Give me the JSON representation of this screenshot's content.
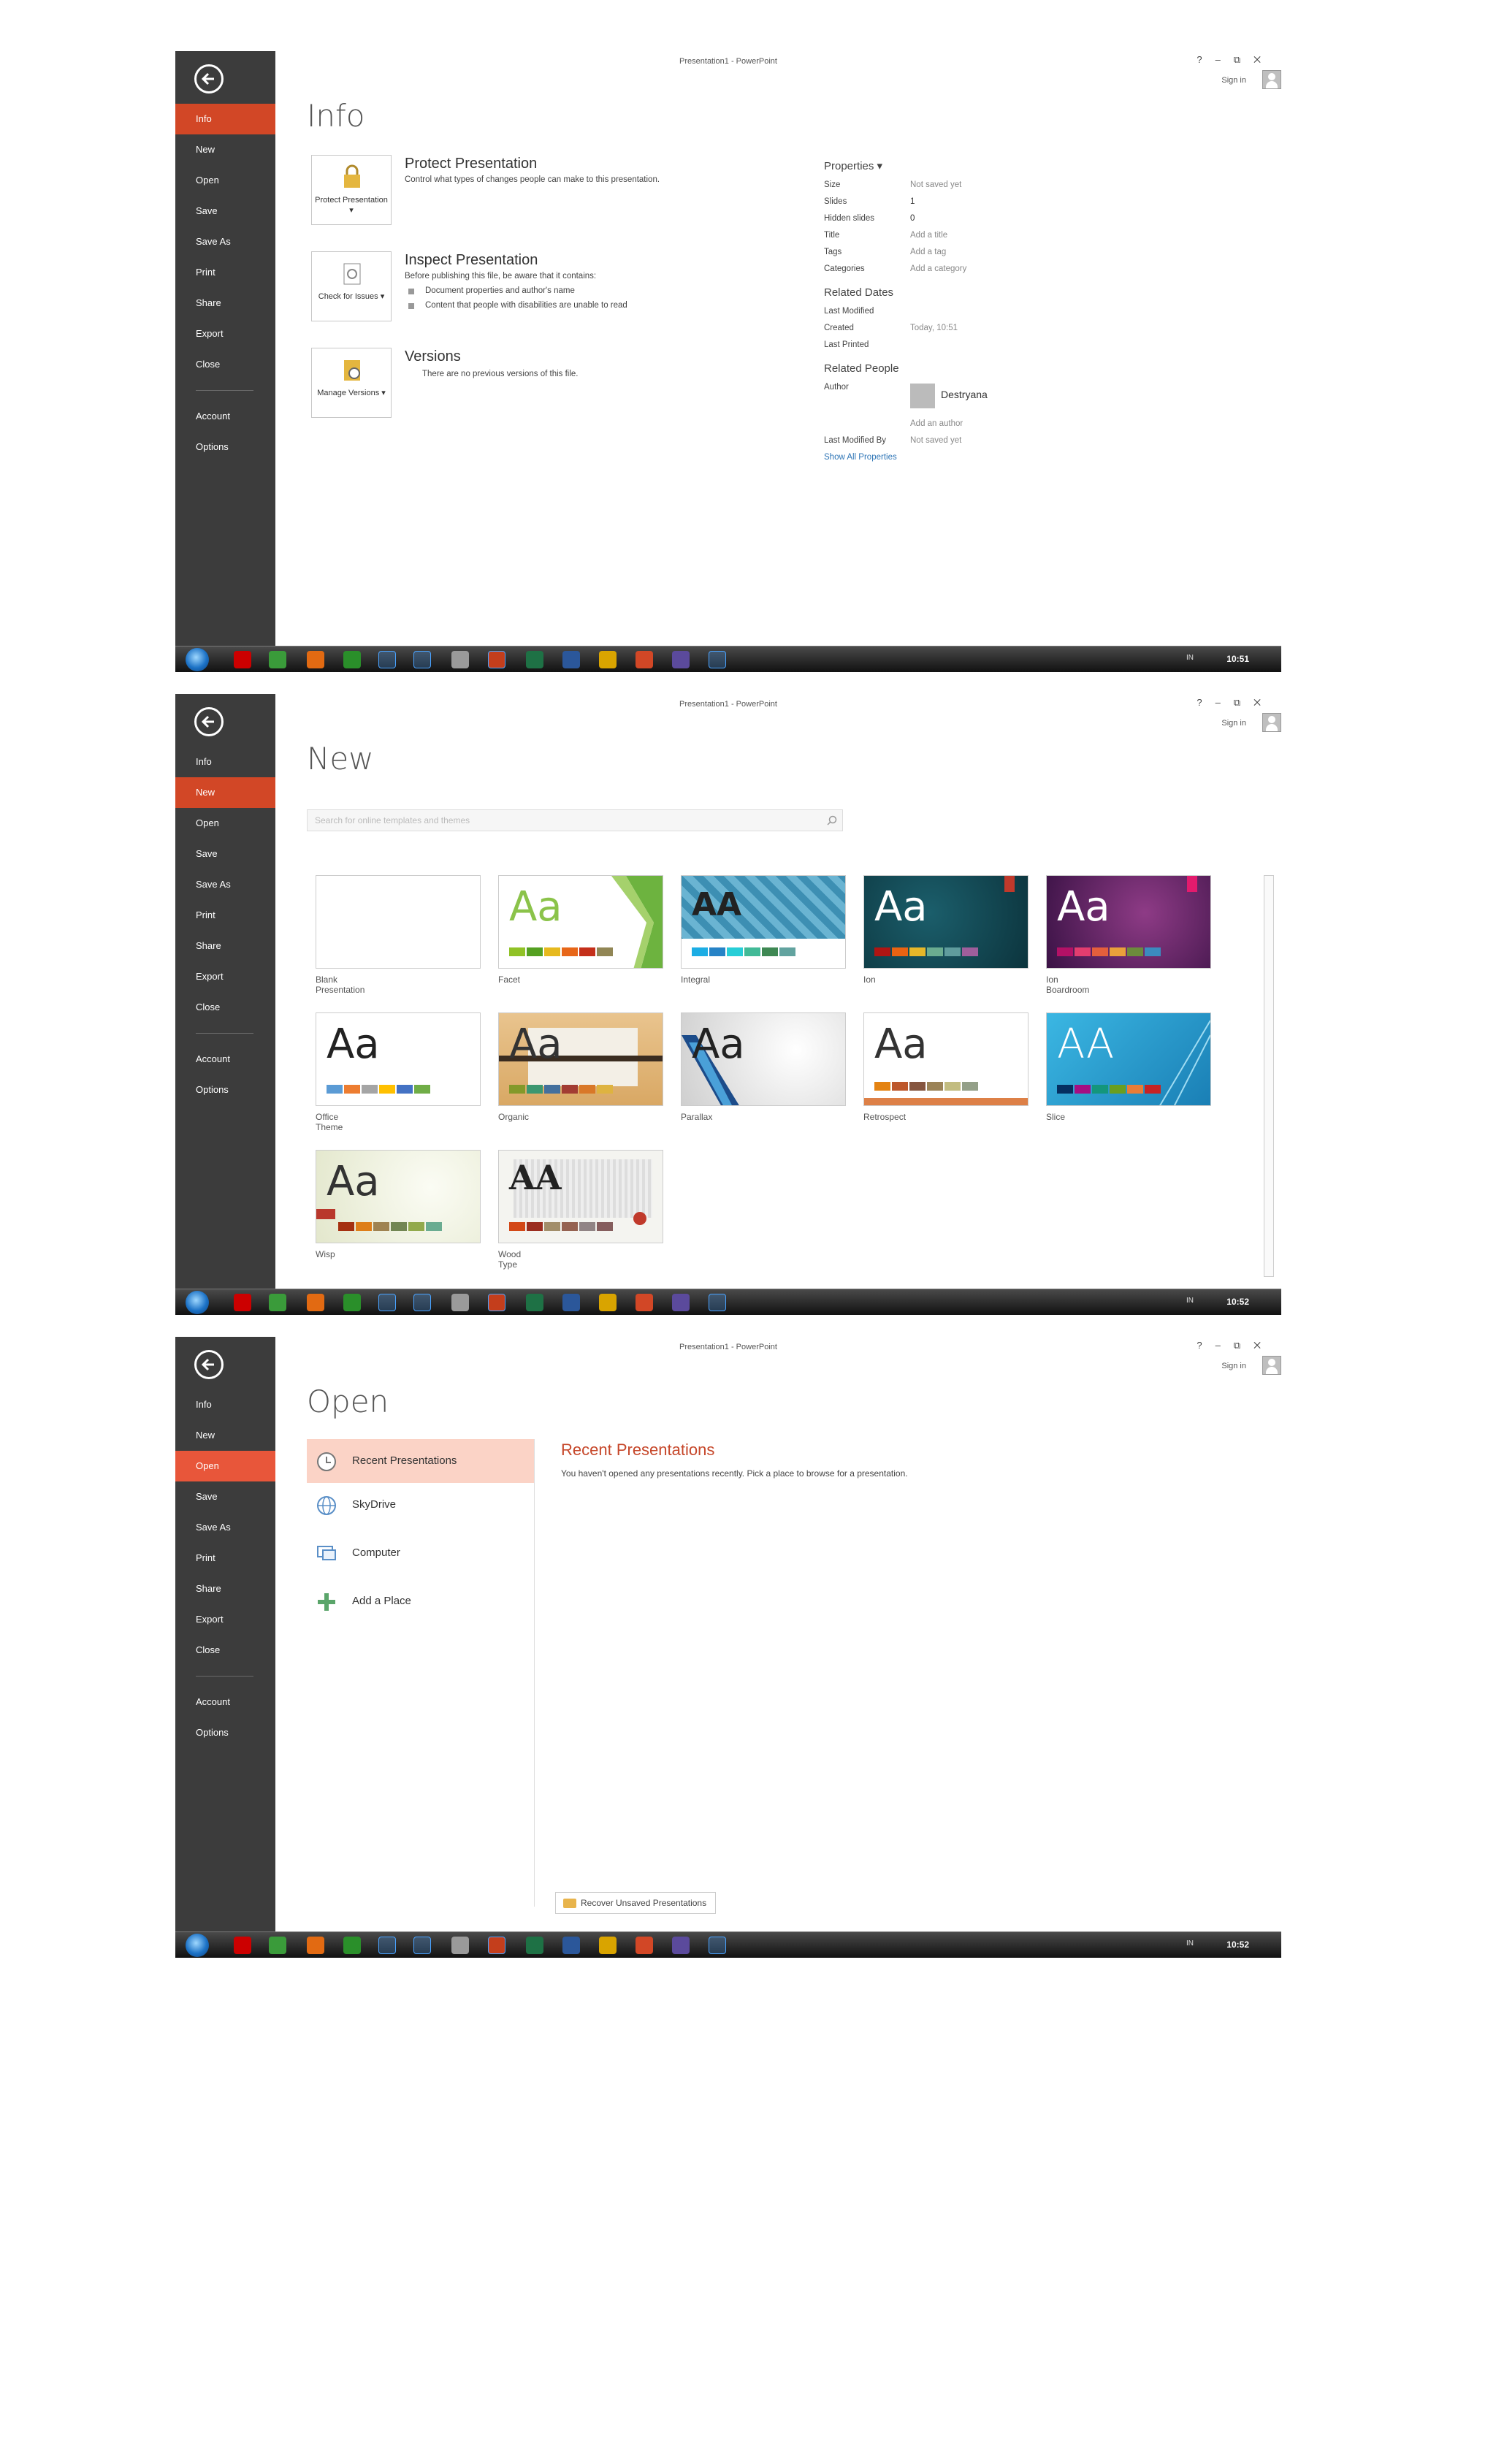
{
  "titlebar": {
    "title": "Presentation1 - PowerPoint",
    "help": "?",
    "minimize": "–",
    "restore": "⧉",
    "close": "✕",
    "sign_in": "Sign in"
  },
  "menu": {
    "info": "Info",
    "new": "New",
    "open": "Open",
    "save": "Save",
    "save_as": "Save As",
    "print": "Print",
    "share": "Share",
    "export": "Export",
    "close": "Close",
    "account": "Account",
    "options": "Options"
  },
  "taskbar": {
    "tray_lang": "IN",
    "clock_1": "10:51",
    "clock_2": "10:52",
    "clock_3": "10:52"
  },
  "info": {
    "title": "Info",
    "protect": {
      "button": "Protect Presentation ▾",
      "title": "Protect Presentation",
      "desc": "Control what types of changes people can make to this presentation."
    },
    "inspect": {
      "button": "Check for Issues ▾",
      "title": "Inspect Presentation",
      "desc": "Before publishing this file, be aware that it contains:",
      "bullet1": "Document properties and author's name",
      "bullet2": "Content that people with disabilities are unable to read"
    },
    "versions": {
      "button": "Manage Versions ▾",
      "title": "Versions",
      "desc": "There are no previous versions of this file."
    },
    "properties": {
      "heading": "Properties ▾",
      "size_k": "Size",
      "size_v": "Not saved yet",
      "slides_k": "Slides",
      "slides_v": "1",
      "hidden_k": "Hidden slides",
      "hidden_v": "0",
      "title_k": "Title",
      "title_v": "Add a title",
      "tags_k": "Tags",
      "tags_v": "Add a tag",
      "categories_k": "Categories",
      "categories_v": "Add a category",
      "dates_heading": "Related Dates",
      "last_modified_k": "Last Modified",
      "created_k": "Created",
      "created_v": "Today, 10:51",
      "last_printed_k": "Last Printed",
      "people_heading": "Related People",
      "author_k": "Author",
      "author_v": "Destryana",
      "add_author": "Add an author",
      "last_modified_by_k": "Last Modified By",
      "last_modified_by_v": "Not saved yet",
      "show_all": "Show All Properties"
    }
  },
  "new": {
    "title": "New",
    "search_placeholder": "Search for online templates and themes",
    "templates": [
      {
        "name": "Blank Presentation"
      },
      {
        "name": "Facet"
      },
      {
        "name": "Integral"
      },
      {
        "name": "Ion"
      },
      {
        "name": "Ion Boardroom"
      },
      {
        "name": "Office Theme"
      },
      {
        "name": "Organic"
      },
      {
        "name": "Parallax"
      },
      {
        "name": "Retrospect"
      },
      {
        "name": "Slice"
      },
      {
        "name": "Wisp"
      },
      {
        "name": "Wood Type"
      }
    ],
    "aa": "Aa",
    "aa_caps": "AA"
  },
  "open": {
    "title": "Open",
    "places": {
      "recent": "Recent Presentations",
      "skydrive": "SkyDrive",
      "computer": "Computer",
      "add_place": "Add a Place"
    },
    "recent_title": "Recent Presentations",
    "recent_desc": "You haven't opened any presentations recently. Pick a place to browse for a presentation.",
    "recover": "Recover Unsaved Presentations"
  },
  "colors": {
    "accent": "#d24726",
    "sidebar": "#3c3c3c",
    "open_highlight": "#fbd3c6"
  }
}
